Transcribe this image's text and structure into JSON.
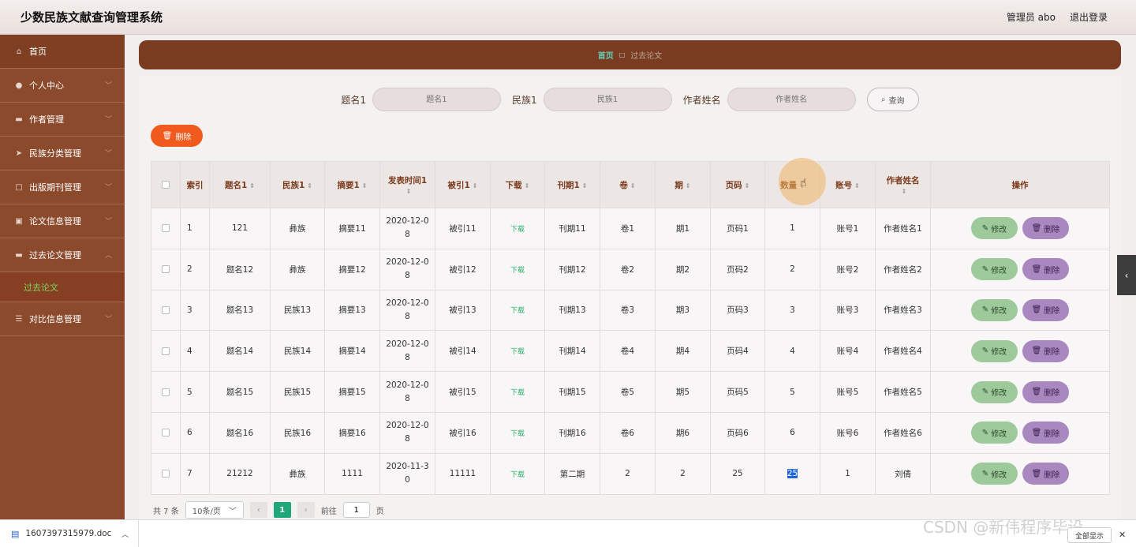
{
  "header": {
    "title": "少数民族文献查询管理系统",
    "user": "管理员 abo",
    "logout": "退出登录"
  },
  "sidebar": {
    "items": [
      {
        "label": "首页",
        "icon": "home-icon",
        "glyph": "⌂"
      },
      {
        "label": "个人中心",
        "icon": "user-icon",
        "glyph": "●"
      },
      {
        "label": "作者管理",
        "icon": "monitor-icon",
        "glyph": "▬"
      },
      {
        "label": "民族分类管理",
        "icon": "send-icon",
        "glyph": "➤"
      },
      {
        "label": "出版期刊管理",
        "icon": "square-icon",
        "glyph": "□"
      },
      {
        "label": "论文信息管理",
        "icon": "clipboard-icon",
        "glyph": "▣"
      },
      {
        "label": "过去论文管理",
        "icon": "monitor-icon",
        "glyph": "▬"
      },
      {
        "label": "对比信息管理",
        "icon": "list-icon",
        "glyph": "☰"
      }
    ],
    "active_submenu": "过去论文"
  },
  "breadcrumb": {
    "home": "首页",
    "current": "过去论文"
  },
  "search": {
    "fields": [
      {
        "label": "题名1",
        "placeholder": "题名1"
      },
      {
        "label": "民族1",
        "placeholder": "民族1"
      },
      {
        "label": "作者姓名",
        "placeholder": "作者姓名"
      }
    ],
    "button": "查询"
  },
  "bulk_delete": "删除",
  "table": {
    "headers": [
      "索引",
      "题名1",
      "民族1",
      "摘要1",
      "发表时间1",
      "被引1",
      "下载",
      "刊期1",
      "卷",
      "期",
      "页码",
      "数量",
      "账号",
      "作者姓名",
      "操作"
    ],
    "rows": [
      [
        "1",
        "121",
        "彝族",
        "摘要11",
        "2020-12-08",
        "被引11",
        "下载",
        "刊期11",
        "卷1",
        "期1",
        "页码1",
        "1",
        "账号1",
        "作者姓名1"
      ],
      [
        "2",
        "题名12",
        "彝族",
        "摘要12",
        "2020-12-08",
        "被引12",
        "下载",
        "刊期12",
        "卷2",
        "期2",
        "页码2",
        "2",
        "账号2",
        "作者姓名2"
      ],
      [
        "3",
        "题名13",
        "民族13",
        "摘要13",
        "2020-12-08",
        "被引13",
        "下载",
        "刊期13",
        "卷3",
        "期3",
        "页码3",
        "3",
        "账号3",
        "作者姓名3"
      ],
      [
        "4",
        "题名14",
        "民族14",
        "摘要14",
        "2020-12-08",
        "被引14",
        "下载",
        "刊期14",
        "卷4",
        "期4",
        "页码4",
        "4",
        "账号4",
        "作者姓名4"
      ],
      [
        "5",
        "题名15",
        "民族15",
        "摘要15",
        "2020-12-08",
        "被引15",
        "下载",
        "刊期15",
        "卷5",
        "期5",
        "页码5",
        "5",
        "账号5",
        "作者姓名5"
      ],
      [
        "6",
        "题名16",
        "民族16",
        "摘要16",
        "2020-12-08",
        "被引16",
        "下载",
        "刊期16",
        "卷6",
        "期6",
        "页码6",
        "6",
        "账号6",
        "作者姓名6"
      ],
      [
        "7",
        "21212",
        "彝族",
        "1111",
        "2020-11-30",
        "11111",
        "下载",
        "第二期",
        "2",
        "2",
        "25",
        "25",
        "1",
        "刘倩"
      ]
    ],
    "edit_label": "修改",
    "delete_label": "删除"
  },
  "pagination": {
    "total": "共 7 条",
    "page_size": "10条/页",
    "current_page": "1",
    "goto_label": "前往",
    "goto_value": "1",
    "page_unit": "页"
  },
  "download_bar": {
    "file": "1607397315979.doc",
    "show_all": "全部显示"
  },
  "watermark": "CSDN @新伟程序毕设",
  "colors": {
    "sidebar": "#8c4a2c",
    "breadcrumb": "#7a3c20",
    "accent_green": "#1fa77a",
    "delete_orange": "#f05a1c",
    "edit_green": "#9ec99a",
    "delete_purple": "#a987bf"
  }
}
